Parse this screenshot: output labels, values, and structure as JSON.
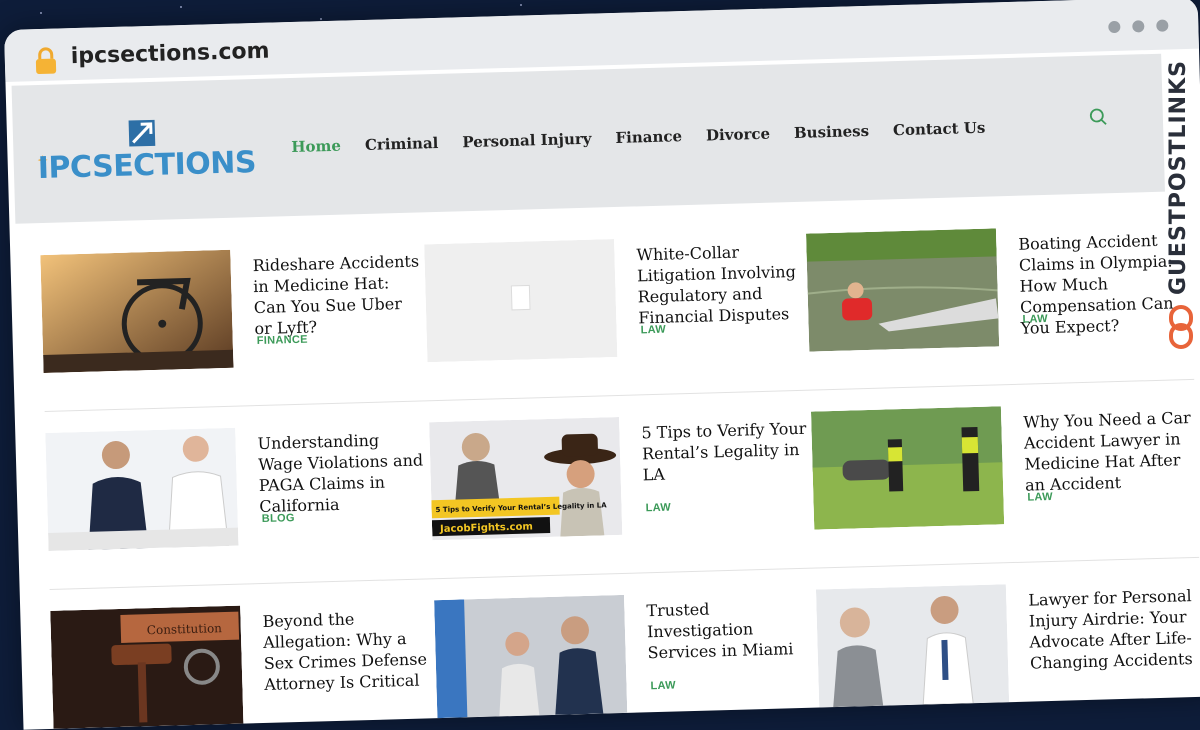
{
  "browser": {
    "url": "ipcsections.com"
  },
  "site": {
    "logo_text": "IPCSECTIONS",
    "brand_color": "#3a8fc9",
    "accent_color": "#3c9a59"
  },
  "nav": {
    "items": [
      {
        "label": "Home",
        "active": true
      },
      {
        "label": "Criminal",
        "active": false
      },
      {
        "label": "Personal Injury",
        "active": false
      },
      {
        "label": "Finance",
        "active": false
      },
      {
        "label": "Divorce",
        "active": false
      },
      {
        "label": "Business",
        "active": false
      },
      {
        "label": "Contact Us",
        "active": false
      }
    ],
    "search_icon": "search-icon"
  },
  "posts": [
    {
      "title": "Rideshare Accidents in Medicine Hat: Can You Sue Uber or Lyft?",
      "category": "FINANCE",
      "thumb": "wheelchair"
    },
    {
      "title": "White-Collar Litigation Involving Regulatory and Financial Disputes",
      "category": "LAW",
      "thumb": "placeholder"
    },
    {
      "title": "Boating Accident Claims in Olympia: How Much Compensation Can You Expect?",
      "category": "LAW",
      "thumb": "water"
    },
    {
      "title": "Understanding Wage Violations and PAGA Claims in California",
      "category": "BLOG",
      "thumb": "office"
    },
    {
      "title": "5 Tips to Verify Your Rental’s Legality in LA",
      "category": "LAW",
      "thumb": "cowboy"
    },
    {
      "title": "Why You Need a Car Accident Lawyer in Medicine Hat After an Accident",
      "category": "LAW",
      "thumb": "police"
    },
    {
      "title": "Beyond the Allegation: Why a Sex Crimes Defense Attorney Is Critical",
      "category": "",
      "thumb": "gavel"
    },
    {
      "title": "Trusted Investigation Services in Miami",
      "category": "LAW",
      "thumb": "meeting"
    },
    {
      "title": "Lawyer for Personal Injury Airdrie: Your Advocate After Life-Changing Accidents",
      "category": "",
      "thumb": "handshake"
    }
  ],
  "thumb_texts": {
    "cowboy_caption": "5 Tips to Verify Your Rental’s Legality in LA",
    "cowboy_brand": "JacobFights.com",
    "gavel_word": "Constitution"
  },
  "badge": {
    "text": "GUESTPOSTLINKS",
    "color": "#e8643a"
  }
}
